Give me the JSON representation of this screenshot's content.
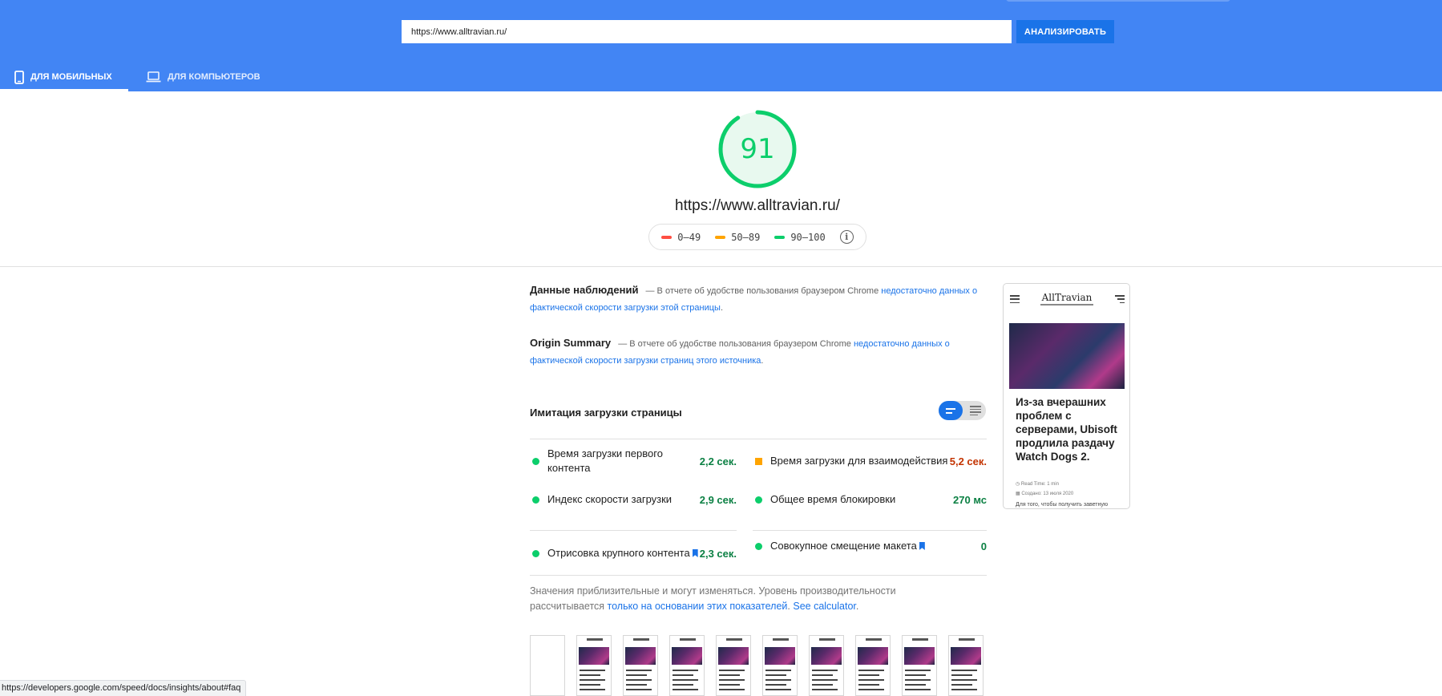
{
  "search": {
    "url_value": "https://www.alltravian.ru/",
    "analyze_label": "АНАЛИЗИРОВАТЬ"
  },
  "tabs": [
    {
      "label": "ДЛЯ МОБИЛЬНЫХ",
      "icon": "phone-icon",
      "active": true
    },
    {
      "label": "ДЛЯ КОМПЬЮТЕРОВ",
      "icon": "laptop-icon",
      "active": false
    }
  ],
  "score": {
    "value": "91",
    "progress": 0.91,
    "color": "#0cce6b",
    "url": "https://www.alltravian.ru/"
  },
  "legend": [
    {
      "range": "0–49",
      "color": "#ff4e42"
    },
    {
      "range": "50–89",
      "color": "#ffa400"
    },
    {
      "range": "90–100",
      "color": "#0cce6b"
    }
  ],
  "field_data": {
    "title": "Данные наблюдений",
    "text": "— В отчете об удобстве пользования браузером Chrome",
    "link": "недостаточно данных о фактической скорости загрузки этой страницы",
    "end": "."
  },
  "origin_summary": {
    "title": "Origin Summary",
    "text": "— В отчете об удобстве пользования браузером Chrome",
    "link": "недостаточно данных о фактической скорости загрузки страниц этого источника",
    "end": "."
  },
  "lab": {
    "title": "Имитация загрузки страницы",
    "metrics": [
      {
        "name": "Время загрузки первого контента",
        "value": "2,2 сек.",
        "status": "good"
      },
      {
        "name": "Время загрузки для взаимодействия",
        "value": "5,2 сек.",
        "status": "average"
      },
      {
        "name": "Индекс скорости загрузки",
        "value": "2,9 сек.",
        "status": "good"
      },
      {
        "name": "Общее время блокировки",
        "value": "270 мс",
        "status": "good"
      },
      {
        "name": "Отрисовка крупного контента",
        "value": "2,3 сек.",
        "status": "good"
      },
      {
        "name": "Совокупное смещение макета",
        "value": "0",
        "status": "good"
      }
    ],
    "note_text": "Значения приблизительные и могут изменяться. Уровень производительности рассчитывается",
    "note_link": "только на основании этих показателей",
    "note_calc": "See calculator",
    "note_end": "."
  },
  "preview": {
    "logo": "AllTravian",
    "headline": "Из-за вчерашних проблем с серверами, Ubisoft продлила раздачу Watch Dogs 2.",
    "read_time": "Read Time: 1 min",
    "created": "Создано: 13 июля 2020",
    "body": "Для того, чтобы получить заветную"
  },
  "status_bar": "https://developers.google.com/speed/docs/insights/about#faq"
}
